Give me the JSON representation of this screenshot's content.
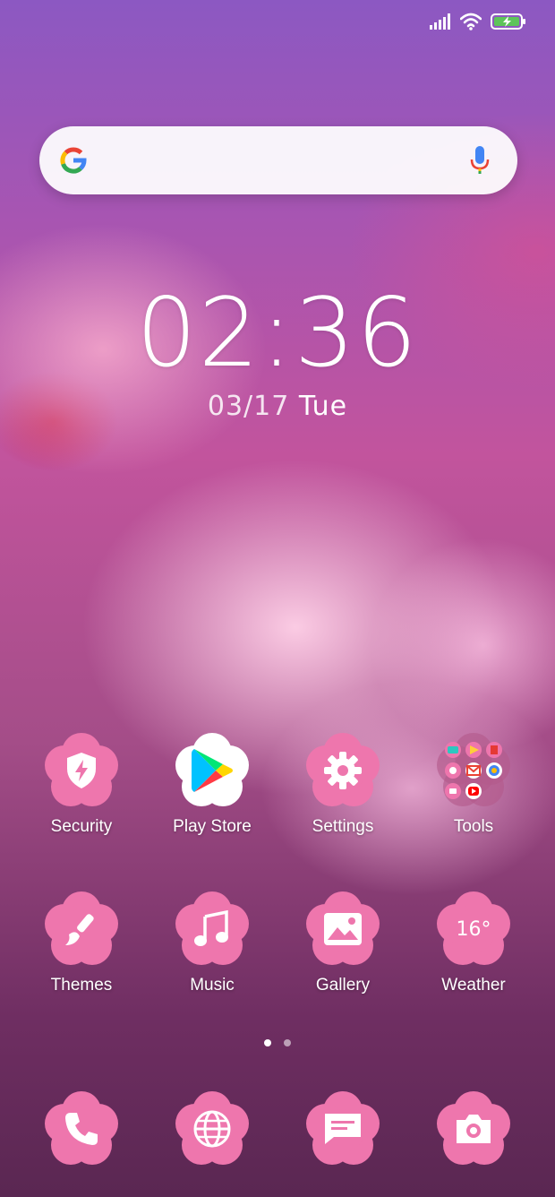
{
  "status_bar": {
    "signal_icon": "cellular-signal-icon",
    "wifi_icon": "wifi-icon",
    "battery_icon": "battery-charging-icon",
    "battery_color": "#5ec45a"
  },
  "search": {
    "logo_icon": "google-g-icon",
    "mic_icon": "microphone-icon"
  },
  "clock": {
    "time": "02:36",
    "date": "03/17",
    "weekday": "Tue"
  },
  "theme": {
    "icon_flower_color": "#ee76ad",
    "label_color": "#ffffff"
  },
  "apps_row1": [
    {
      "label": "Security",
      "icon": "shield-lightning-icon"
    },
    {
      "label": "Play Store",
      "icon": "play-store-icon"
    },
    {
      "label": "Settings",
      "icon": "gear-icon"
    },
    {
      "label": "Tools",
      "icon": "folder-icon"
    }
  ],
  "apps_row2": [
    {
      "label": "Themes",
      "icon": "paintbrush-icon"
    },
    {
      "label": "Music",
      "icon": "music-note-icon"
    },
    {
      "label": "Gallery",
      "icon": "image-icon"
    },
    {
      "label": "Weather",
      "icon": "weather-icon",
      "temp": "16°"
    }
  ],
  "page_indicator": {
    "count": 2,
    "active": 1
  },
  "dock": [
    {
      "icon": "phone-icon"
    },
    {
      "icon": "browser-globe-icon"
    },
    {
      "icon": "messages-icon"
    },
    {
      "icon": "camera-icon"
    }
  ]
}
